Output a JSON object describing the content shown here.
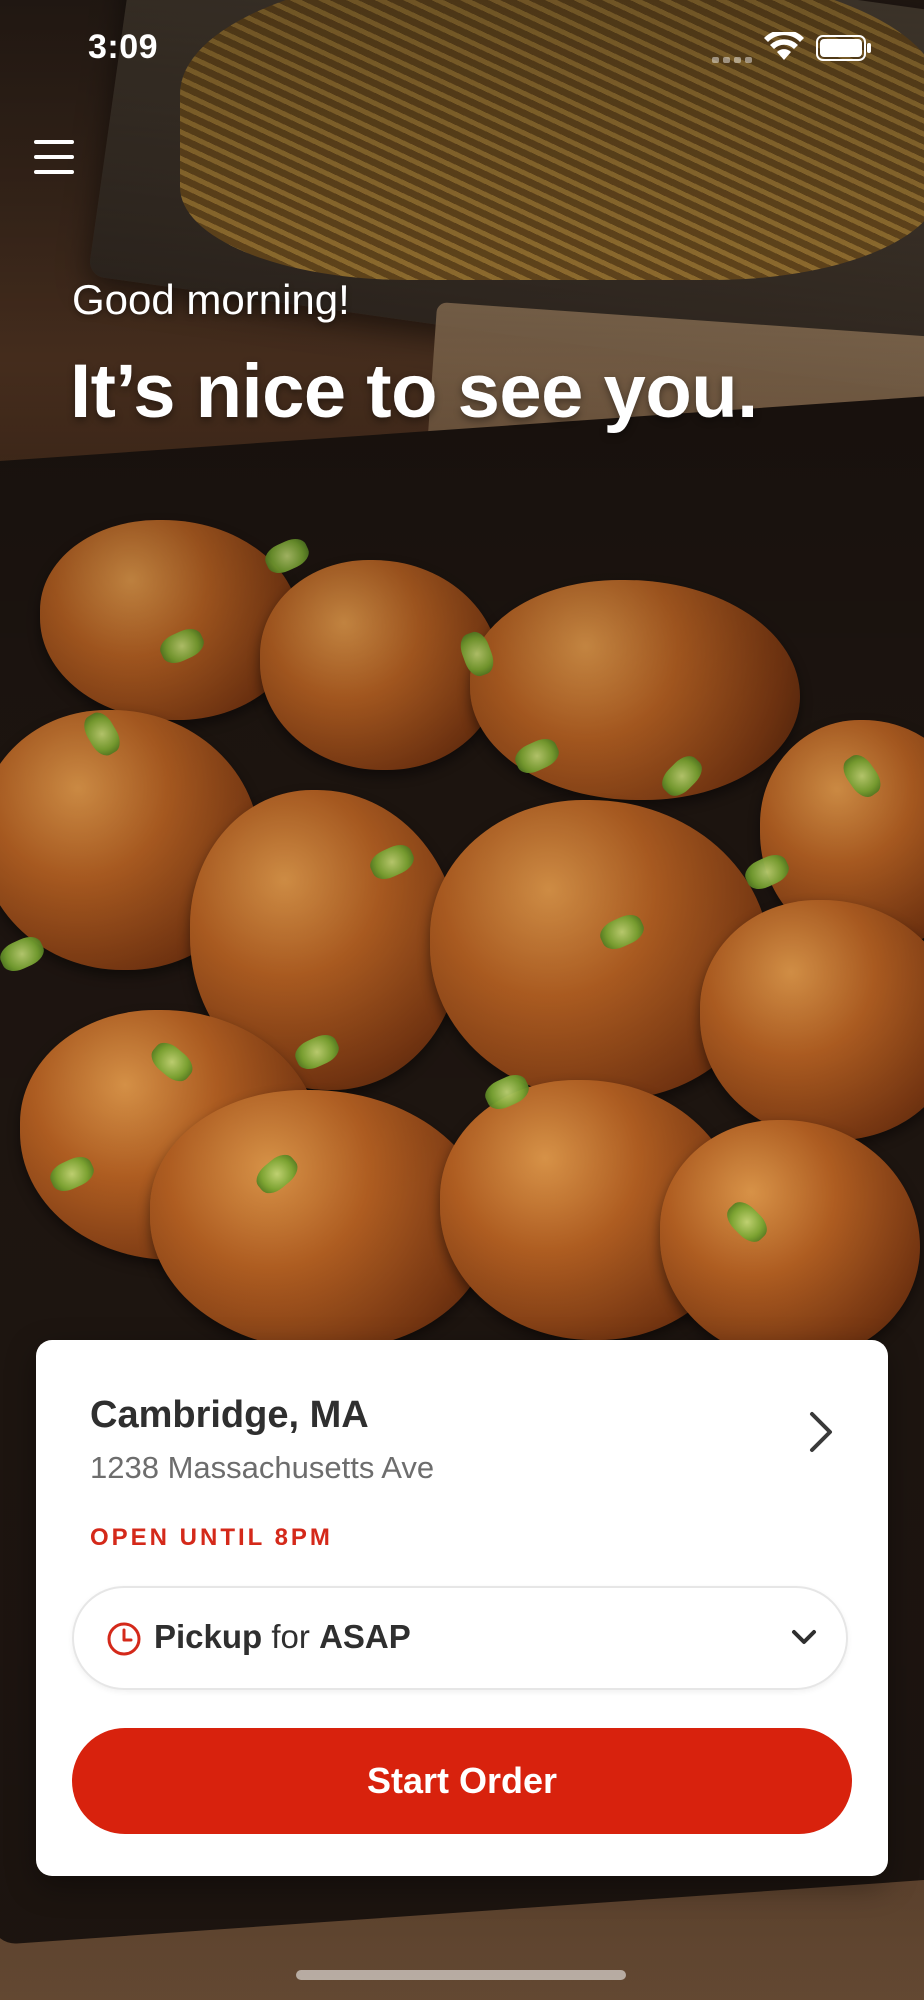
{
  "status_bar": {
    "time": "3:09"
  },
  "header": {
    "menu_icon": "hamburger-menu-icon",
    "greeting": "Good morning!",
    "headline": "It’s nice to see you."
  },
  "location_card": {
    "city": "Cambridge, MA",
    "address": "1238 Massachusetts Ave",
    "hours": "OPEN UNTIL 8PM",
    "pickup": {
      "mode": "Pickup",
      "connector": "for",
      "time": "ASAP"
    },
    "start_order_label": "Start Order"
  },
  "colors": {
    "accent_red": "#d8220d",
    "text_dark": "#2f2f2f",
    "text_muted": "#6d6d6d"
  }
}
